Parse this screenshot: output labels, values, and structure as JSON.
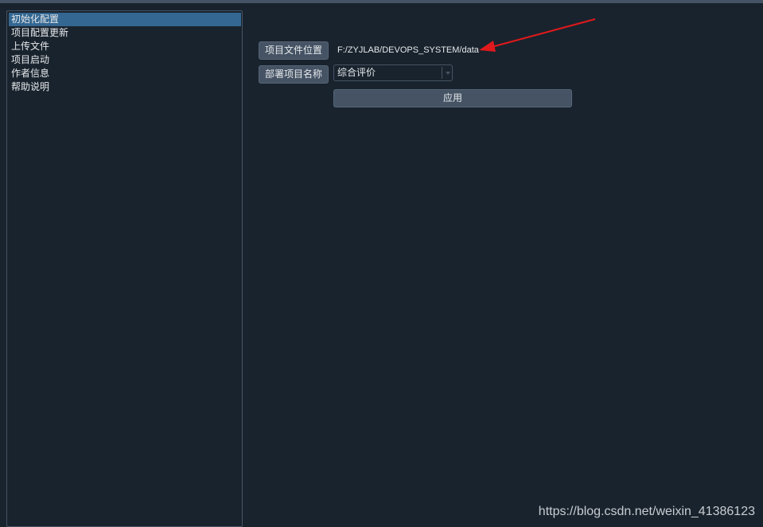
{
  "sidebar": {
    "items": [
      {
        "label": "初始化配置"
      },
      {
        "label": "项目配置更新"
      },
      {
        "label": "上传文件"
      },
      {
        "label": "项目启动"
      },
      {
        "label": "作者信息"
      },
      {
        "label": "帮助说明"
      }
    ]
  },
  "form": {
    "file_location_button": "项目文件位置",
    "file_path": "F:/ZYJLAB/DEVOPS_SYSTEM/data",
    "deploy_name_button": "部署项目名称",
    "project_select_value": "综合评价",
    "apply_button": "应用"
  },
  "watermark": "https://blog.csdn.net/weixin_41386123",
  "colors": {
    "background": "#19232d",
    "selected": "#346792",
    "button": "#455364",
    "annotation": "#e0191c"
  }
}
